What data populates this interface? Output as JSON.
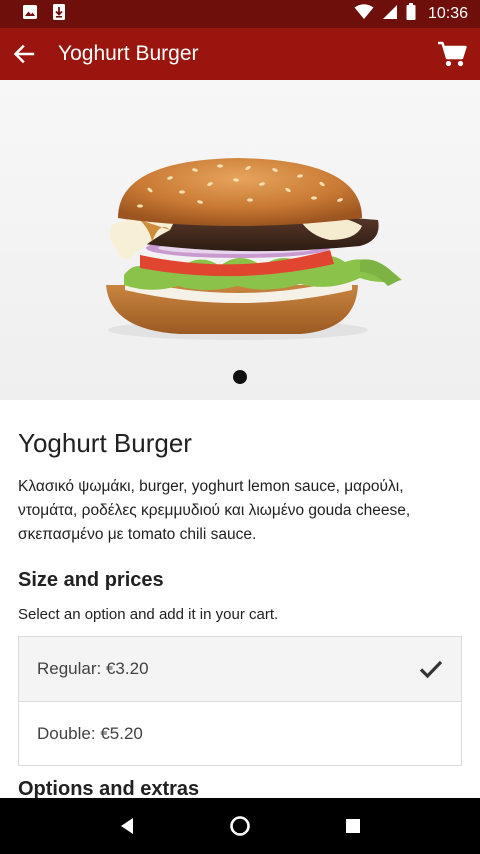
{
  "status_bar": {
    "time": "10:36"
  },
  "app_bar": {
    "title": "Yoghurt Burger"
  },
  "product": {
    "title": "Yoghurt Burger",
    "description": "Κλασικό ψωμάκι, burger, yoghurt lemon sauce, μαρούλι, ντομάτα, ροδέλες κρεμμυδιού και λιωμένο gouda cheese, σκεπασμένο με tomato chili sauce."
  },
  "sizes": {
    "title": "Size and prices",
    "hint": "Select an option and add it in your cart.",
    "options": [
      {
        "label": "Regular: €3.20",
        "selected": true
      },
      {
        "label": "Double: €5.20",
        "selected": false
      }
    ]
  },
  "extras": {
    "title": "Options and extras"
  },
  "colors": {
    "app_bar": "#9b150f",
    "status_bar": "#6e0f0b"
  }
}
